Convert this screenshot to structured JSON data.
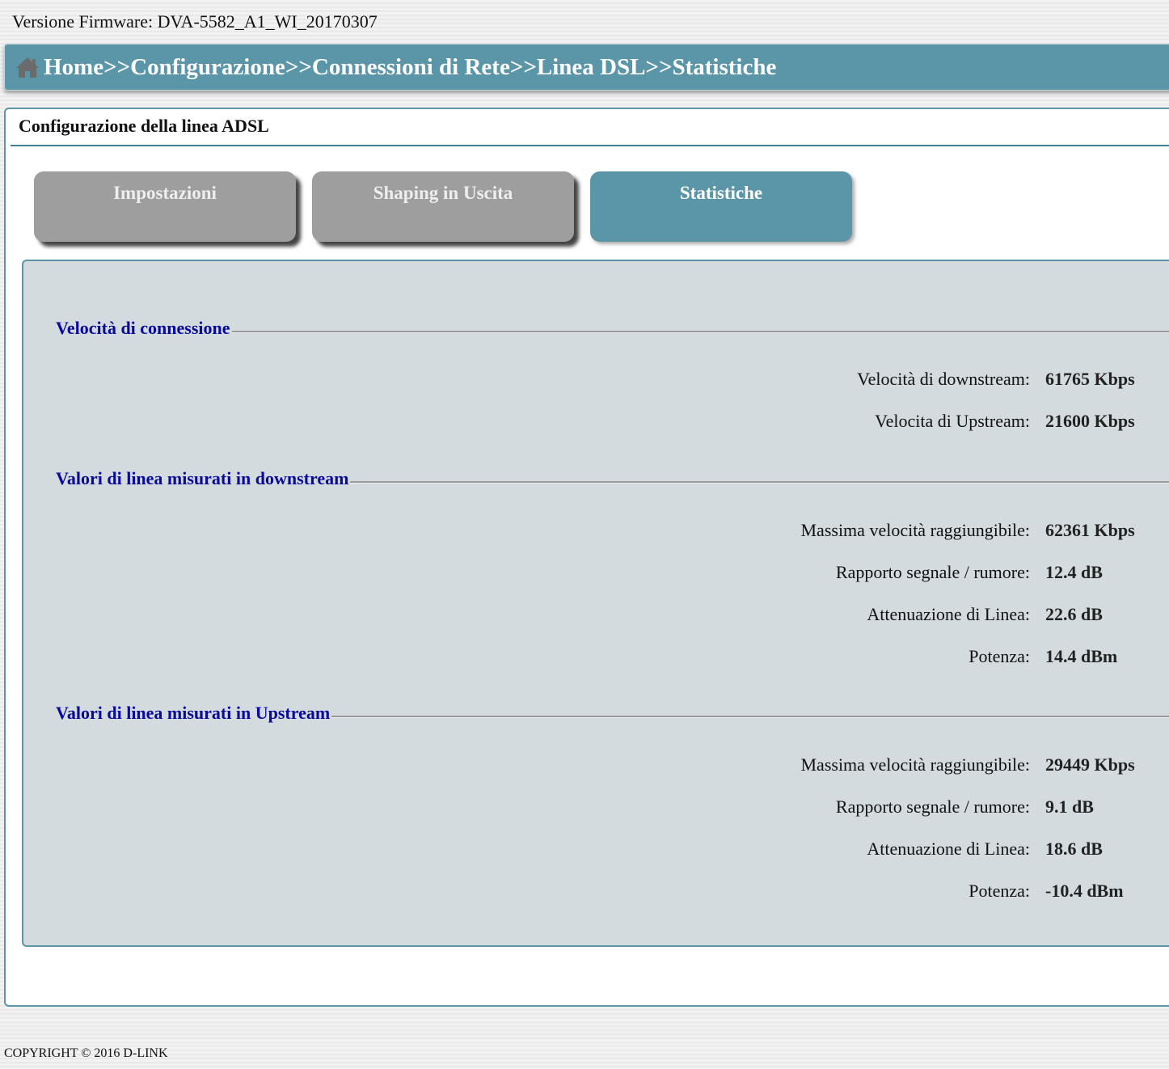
{
  "firmware": "Versione Firmware: DVA-5582_A1_WI_20170307",
  "breadcrumb": "Home>>Configurazione>>Connessioni di Rete>>Linea DSL>>Statistiche",
  "title": "Configurazione della linea ADSL",
  "tabs": [
    {
      "label": "Impostazioni"
    },
    {
      "label": "Shaping in Uscita"
    },
    {
      "label": "Statistiche",
      "active": true
    }
  ],
  "sections": [
    {
      "title": "Velocità di connessione",
      "rows": [
        {
          "label": "Velocità di downstream:",
          "value": "61765 Kbps"
        },
        {
          "label": "Velocita di Upstream:",
          "value": "21600 Kbps"
        }
      ]
    },
    {
      "title": "Valori di linea misurati in downstream",
      "rows": [
        {
          "label": "Massima velocità raggiungibile:",
          "value": "62361 Kbps"
        },
        {
          "label": "Rapporto segnale / rumore:",
          "value": "12.4 dB"
        },
        {
          "label": "Attenuazione di Linea:",
          "value": "22.6 dB"
        },
        {
          "label": "Potenza:",
          "value": "14.4 dBm"
        }
      ]
    },
    {
      "title": "Valori di linea misurati in Upstream",
      "rows": [
        {
          "label": "Massima velocità raggiungibile:",
          "value": "29449 Kbps"
        },
        {
          "label": "Rapporto segnale / rumore:",
          "value": "9.1 dB"
        },
        {
          "label": "Attenuazione di Linea:",
          "value": "18.6 dB"
        },
        {
          "label": "Potenza:",
          "value": "-10.4 dBm"
        }
      ]
    }
  ],
  "footer": "COPYRIGHT © 2016 D-LINK"
}
